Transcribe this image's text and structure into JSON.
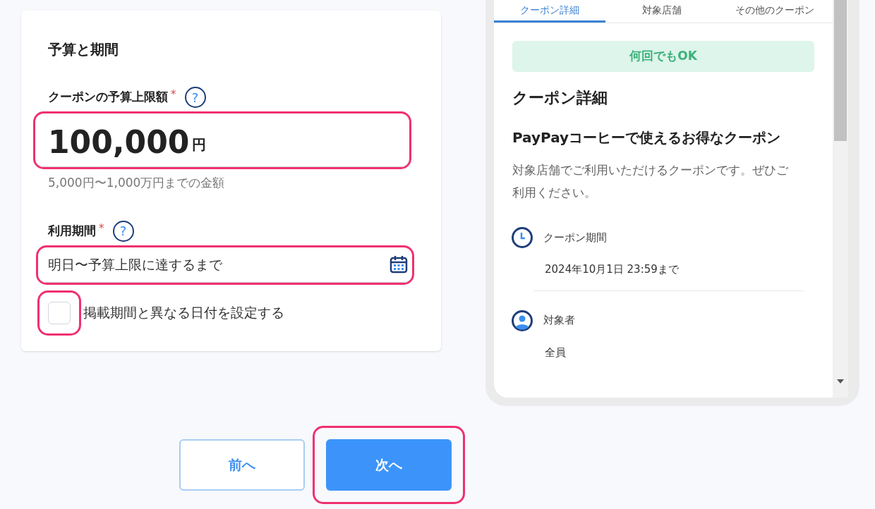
{
  "form": {
    "title": "予算と期間",
    "budget": {
      "label": "クーポンの予算上限額",
      "required_mark": "*",
      "help": "?",
      "value": "100,000",
      "unit": "円",
      "hint": "5,000円〜1,000万円までの金額",
      "highlighted": true
    },
    "period": {
      "label": "利用期間",
      "required_mark": "*",
      "help": "?",
      "value": "明日〜予算上限に達するまで",
      "highlighted": true
    },
    "different_dates": {
      "label": "掲載期間と異なる日付を設定する",
      "checked": false,
      "highlighted": true
    }
  },
  "preview": {
    "tabs": [
      {
        "label": "クーポン詳細",
        "selected": true
      },
      {
        "label": "対象店舗",
        "selected": false
      },
      {
        "label": "その他のクーポン",
        "selected": false
      }
    ],
    "badge": "何回でもOK",
    "heading": "クーポン詳細",
    "coupon_title": "PayPayコーヒーで使えるお得なクーポン",
    "description": "対象店舗でご利用いただけるクーポンです。ぜひご利用ください。",
    "details": [
      {
        "kind": "clock",
        "label": "クーポン期間",
        "value": "2024年10月1日 23:59まで"
      },
      {
        "kind": "person",
        "label": "対象者",
        "value": "全員"
      }
    ]
  },
  "buttons": [
    {
      "label": "前へ",
      "kind": "secondary",
      "highlighted": false
    },
    {
      "label": "次へ",
      "kind": "primary",
      "highlighted": true
    }
  ]
}
